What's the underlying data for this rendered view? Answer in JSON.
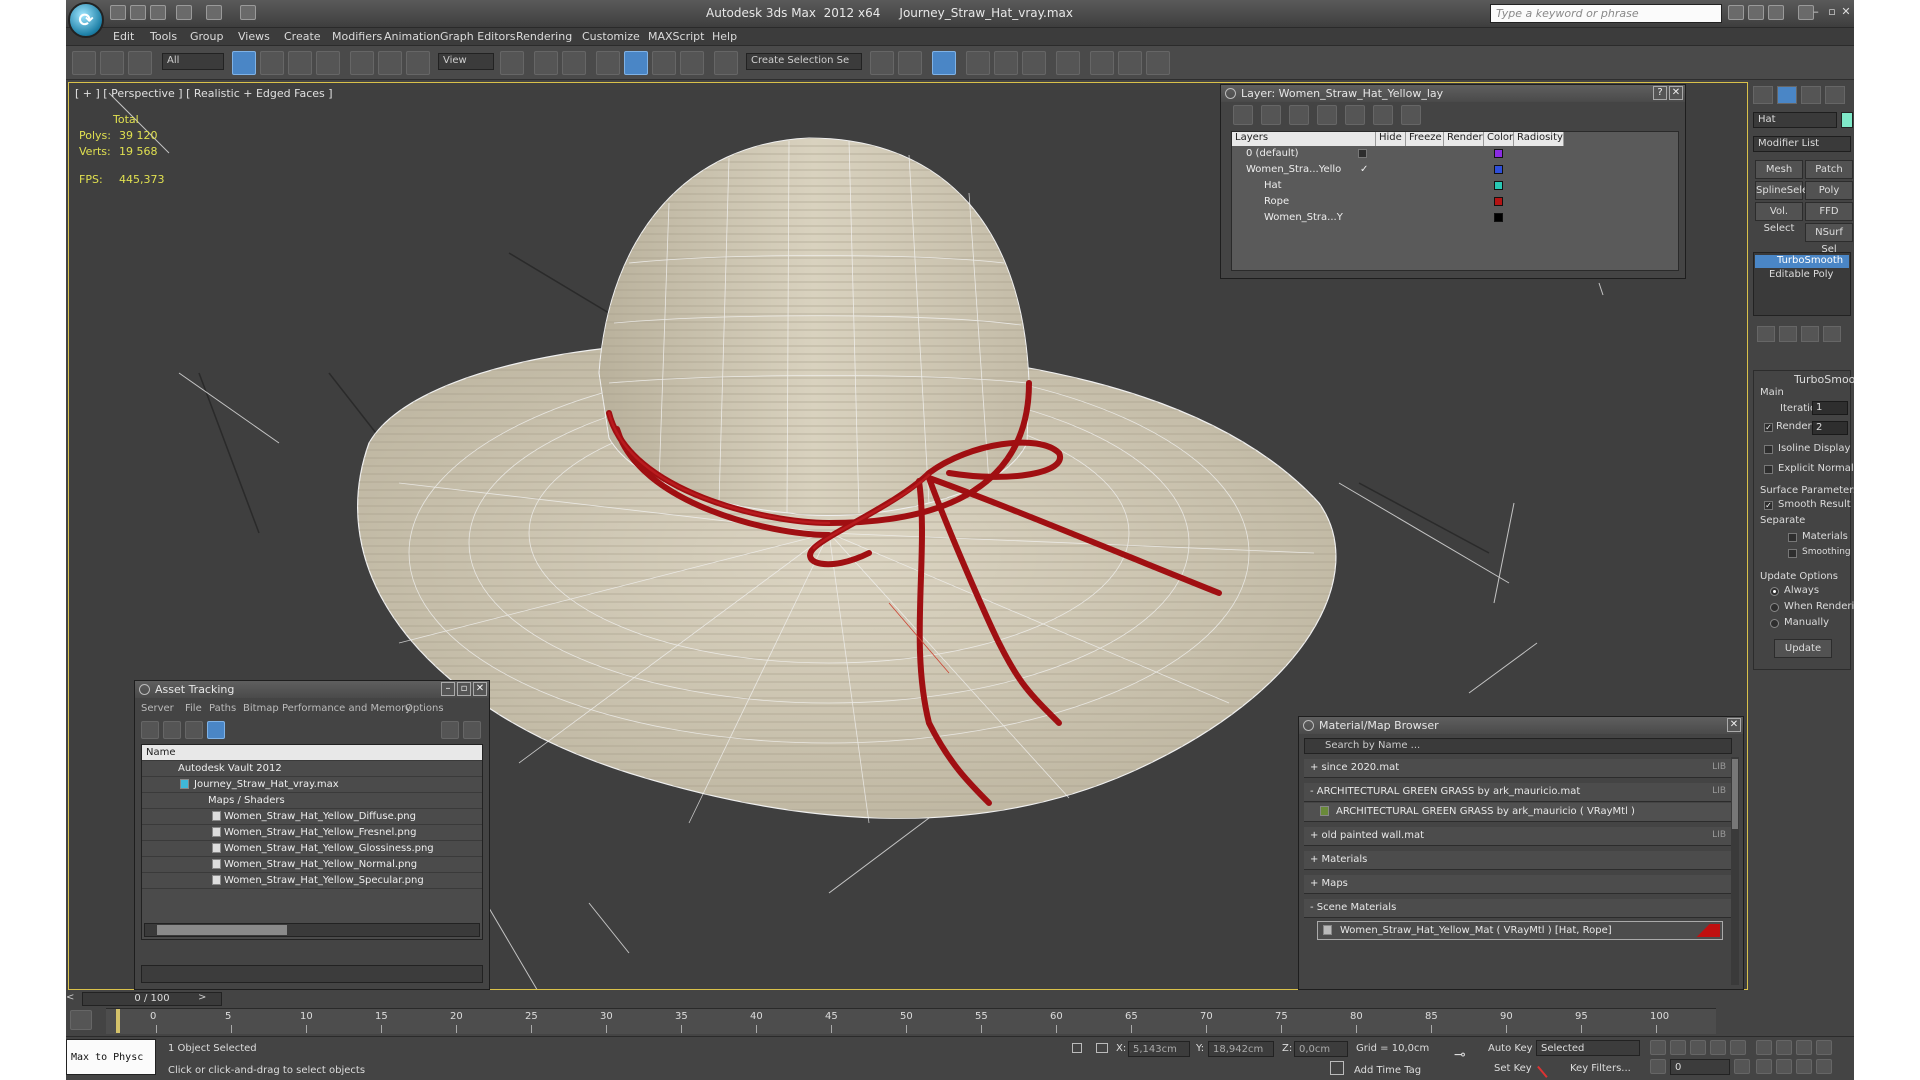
{
  "window": {
    "title": "Autodesk 3ds Max  2012 x64     Journey_Straw_Hat_vray.max",
    "search_placeholder": "Type a keyword or phrase"
  },
  "menu": [
    "Edit",
    "Tools",
    "Group",
    "Views",
    "Create",
    "Modifiers",
    "Animation",
    "Graph Editors",
    "Rendering",
    "Customize",
    "MAXScript",
    "Help"
  ],
  "toolbar": {
    "filter_select": "All",
    "ref_coord_select": "View",
    "selection_set_placeholder": "Create Selection Se"
  },
  "viewport": {
    "label": "[ + ] [ Perspective ] [ Realistic + Edged Faces ]",
    "stats": {
      "total_label": "Total",
      "polys_label": "Polys:",
      "polys_value": "39 120",
      "verts_label": "Verts:",
      "verts_value": "19 568",
      "fps_label": "FPS:",
      "fps_value": "445,373"
    }
  },
  "layer_panel": {
    "title": "Layer: Women_Straw_Hat_Yellow_lay",
    "columns": [
      "Layers",
      "Hide",
      "Freeze",
      "Render",
      "Color",
      "Radiosity"
    ],
    "rows": [
      {
        "name": "0 (default)",
        "color": "#8a2be2"
      },
      {
        "name": "Women_Stra...Yello",
        "color": "#2f4fd8"
      },
      {
        "name": "Hat",
        "color": "#28c8b4"
      },
      {
        "name": "Rope",
        "color": "#b41414"
      },
      {
        "name": "Women_Stra...Y",
        "color": "#000000"
      }
    ]
  },
  "command_panel": {
    "object_name": "Hat",
    "object_color": "#7fe8c8",
    "modifier_list": "Modifier List",
    "buttons": [
      "Mesh Select",
      "Patch Select",
      "SplineSelect",
      "Poly Select",
      "Vol. Select",
      "FFD Select",
      "NSurf Sel"
    ],
    "stack": [
      "TurboSmooth",
      "Editable Poly"
    ],
    "rollout_title": "TurboSmooth",
    "main_label": "Main",
    "iterations_label": "Iterations:",
    "iterations_value": "1",
    "render_iters_label": "Render Iters:",
    "render_iters_value": "2",
    "isoline_label": "Isoline Display",
    "explicit_normals_label": "Explicit Normals",
    "surface_params_label": "Surface Parameters",
    "smooth_result_label": "Smooth Result",
    "separate_label": "Separate",
    "materials_label": "Materials",
    "smoothing_groups_label": "Smoothing Groups",
    "update_options_label": "Update Options",
    "always_label": "Always",
    "when_rendering_label": "When Rendering",
    "manually_label": "Manually",
    "update_button": "Update"
  },
  "asset_panel": {
    "title": "Asset Tracking",
    "menu": [
      "Server",
      "File",
      "Paths",
      "Bitmap Performance and Memory",
      "Options"
    ],
    "column": "Name",
    "rows": [
      "Autodesk Vault 2012",
      "Journey_Straw_Hat_vray.max",
      "Maps / Shaders",
      "Women_Straw_Hat_Yellow_Diffuse.png",
      "Women_Straw_Hat_Yellow_Fresnel.png",
      "Women_Straw_Hat_Yellow_Glossiness.png",
      "Women_Straw_Hat_Yellow_Normal.png",
      "Women_Straw_Hat_Yellow_Specular.png"
    ]
  },
  "material_panel": {
    "title": "Material/Map Browser",
    "search_placeholder": "Search by Name ...",
    "lib_tag": "LIB",
    "rows": [
      "+ since 2020.mat",
      "- ARCHITECTURAL GREEN GRASS by ark_mauricio.mat",
      "ARCHITECTURAL GREEN GRASS by ark_mauricio  ( VRayMtl )",
      "+ old painted wall.mat",
      "+ Materials",
      "+ Maps",
      "- Scene Materials",
      "Women_Straw_Hat_Yellow_Mat  ( VRayMtl )  [Hat, Rope]"
    ]
  },
  "timeline": {
    "slider": "0 / 100",
    "ticks": [
      "0",
      "5",
      "10",
      "15",
      "20",
      "25",
      "30",
      "35",
      "40",
      "45",
      "50",
      "55",
      "60",
      "65",
      "70",
      "75",
      "80",
      "85",
      "90",
      "95",
      "100"
    ]
  },
  "status": {
    "script_button": "Max to Physc",
    "selection": "1 Object Selected",
    "prompt": "Click or click-and-drag to select objects",
    "x_label": "X:",
    "x_value": "5,143cm",
    "y_label": "Y:",
    "y_value": "18,942cm",
    "z_label": "Z:",
    "z_value": "0,0cm",
    "grid": "Grid = 10,0cm",
    "add_time_tag": "Add Time Tag",
    "auto_key": "Auto Key",
    "set_key": "Set Key",
    "key_mode": "Selected",
    "key_filters": "Key Filters...",
    "frame": "0"
  }
}
